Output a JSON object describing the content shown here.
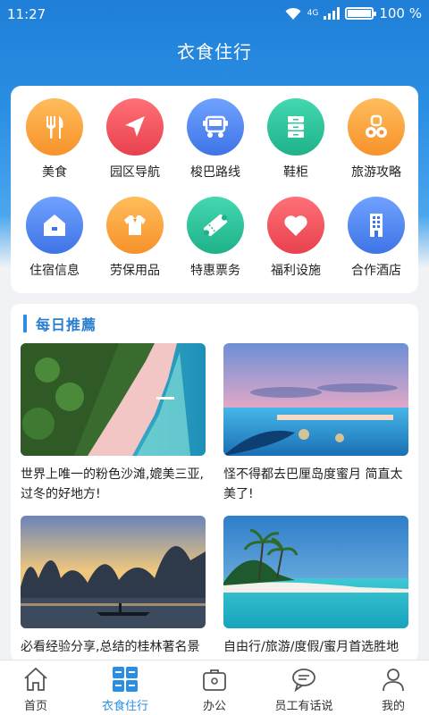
{
  "status": {
    "time": "11:27",
    "network": "4G",
    "battery": "100 %"
  },
  "header": {
    "title": "衣食住行"
  },
  "grid": [
    {
      "label": "美食",
      "icon": "fork-knife-icon",
      "color": "#f8a03a"
    },
    {
      "label": "园区导航",
      "icon": "navigation-arrow-icon",
      "color": "#ef5460"
    },
    {
      "label": "梭巴路线",
      "icon": "bus-icon",
      "color": "#4f86ee"
    },
    {
      "label": "鞋柜",
      "icon": "cabinet-icon",
      "color": "#2ac39a"
    },
    {
      "label": "旅游攻略",
      "icon": "binoculars-icon",
      "color": "#f8a03a"
    },
    {
      "label": "住宿信息",
      "icon": "house-icon",
      "color": "#4f86ee"
    },
    {
      "label": "劳保用品",
      "icon": "shirt-icon",
      "color": "#f8a03a"
    },
    {
      "label": "特惠票务",
      "icon": "ticket-icon",
      "color": "#2ac39a"
    },
    {
      "label": "福利设施",
      "icon": "heart-icon",
      "color": "#ef5460"
    },
    {
      "label": "合作酒店",
      "icon": "hotel-icon",
      "color": "#4f86ee"
    }
  ],
  "daily": {
    "title": "每日推薦",
    "articles": [
      {
        "caption": "世界上唯一的粉色沙滩,媲美三亚,过冬的好地方!"
      },
      {
        "caption": "怪不得都去巴厘岛度蜜月 简直太美了!"
      },
      {
        "caption": "必看经验分享,总结的桂林著名景点攻略"
      },
      {
        "caption": "自由行/旅游/度假/蜜月首选胜地"
      }
    ]
  },
  "tabs": [
    {
      "label": "首页",
      "icon": "home-icon"
    },
    {
      "label": "衣食住行",
      "icon": "grid-app-icon",
      "active": true
    },
    {
      "label": "办公",
      "icon": "briefcase-icon"
    },
    {
      "label": "员工有话说",
      "icon": "chat-bubble-icon"
    },
    {
      "label": "我的",
      "icon": "user-icon"
    }
  ]
}
